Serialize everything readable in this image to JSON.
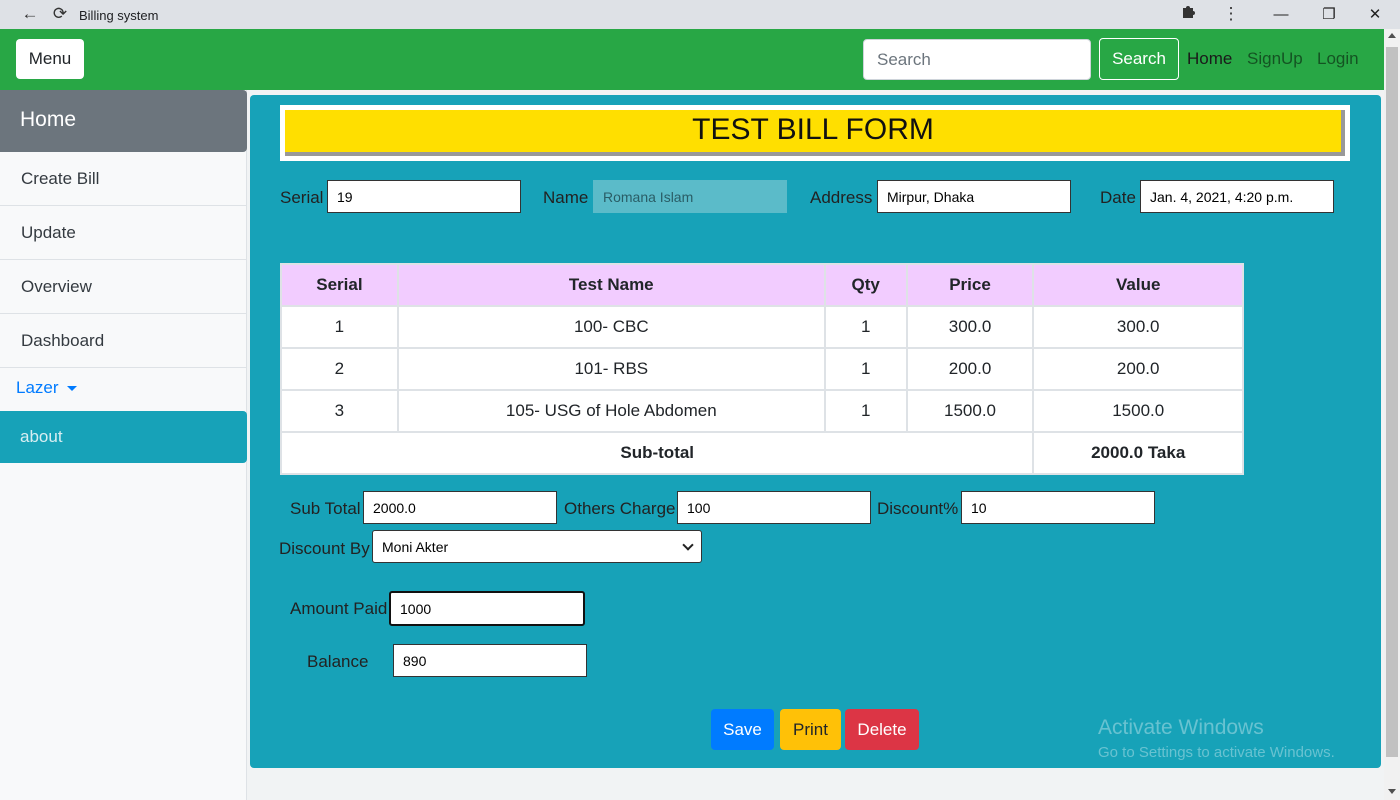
{
  "browser": {
    "tab_title": "Billing system"
  },
  "navbar": {
    "menu_label": "Menu",
    "search_placeholder": "Search",
    "search_button": "Search",
    "links": {
      "home": "Home",
      "signup": "SignUp",
      "login": "Login"
    },
    "accent_color": "#28a745"
  },
  "sidebar": {
    "home": "Home",
    "items": [
      "Create Bill",
      "Update",
      "Overview",
      "Dashboard"
    ],
    "dropdown": "Lazer",
    "about": "about"
  },
  "form": {
    "title": "TEST BILL FORM",
    "serial_label": "Serial",
    "serial_value": "19",
    "name_label": "Name",
    "name_value": "Romana Islam",
    "address_label": "Address",
    "address_value": "Mirpur, Dhaka",
    "date_label": "Date",
    "date_value": "Jan. 4, 2021, 4:20 p.m."
  },
  "table": {
    "headers": [
      "Serial",
      "Test Name",
      "Qty",
      "Price",
      "Value"
    ],
    "rows": [
      [
        "1",
        "100- CBC",
        "1",
        "300.0",
        "300.0"
      ],
      [
        "2",
        "101- RBS",
        "1",
        "200.0",
        "200.0"
      ],
      [
        "3",
        "105- USG of Hole Abdomen",
        "1",
        "1500.0",
        "1500.0"
      ]
    ],
    "subtotal_label": "Sub-total",
    "subtotal_value": "2000.0 Taka"
  },
  "totals": {
    "sub_total_label": "Sub Total",
    "sub_total_value": "2000.0",
    "others_charge_label": "Others Charge",
    "others_charge_value": "100",
    "discount_label": "Discount%",
    "discount_value": "10",
    "discount_by_label": "Discount By",
    "discount_by_value": "Moni Akter",
    "amount_paid_label": "Amount Paid",
    "amount_paid_value": "1000",
    "balance_label": "Balance",
    "balance_value": "890"
  },
  "actions": {
    "save": "Save",
    "print": "Print",
    "delete": "Delete"
  },
  "watermark": {
    "line1": "Activate Windows",
    "line2": "Go to Settings to activate Windows."
  }
}
